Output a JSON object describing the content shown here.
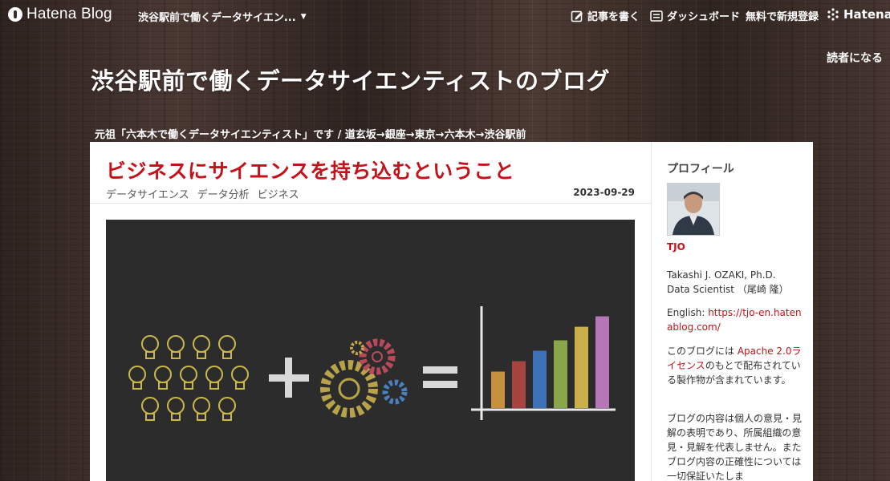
{
  "navbar": {
    "brand": "Hatena Blog",
    "blog_select": "渋谷駅前で働くデータサイエン...",
    "write_post": "記事を書く",
    "dashboard": "ダッシュボード",
    "register": "無料で新規登録",
    "hatena": "Hatena",
    "subscribe": "読者になる"
  },
  "header": {
    "title": "渋谷駅前で働くデータサイエンティストのブログ",
    "description": "元祖「六本木で働くデータサイエンティスト」です / 道玄坂→銀座→東京→六本木→渋谷駅前"
  },
  "entry": {
    "title": "ビジネスにサイエンスを持ち込むということ",
    "categories": [
      "データサイエンス",
      "データ分析",
      "ビジネス"
    ],
    "date": "2023-09-29",
    "eyecatch": {
      "icon": "ideas-plus-gears-equals-chart-illustration",
      "bar_heights": [
        0.35,
        0.45,
        0.55,
        0.65,
        0.78,
        0.88
      ]
    }
  },
  "sidebar": {
    "heading": "プロフィール",
    "name": "TJO",
    "bio_line1": "Takashi J. OZAKI, Ph.D.",
    "bio_line2": "Data Scientist （尾崎 隆）",
    "english_label": "English: ",
    "english_link": "https://tjo-en.hatenablog.com/",
    "license_pre": "このブログには ",
    "license_link": "Apache 2.0ライセンス",
    "license_post": "のもとで配布されている製作物が含まれています。",
    "disclaimer": "ブログの内容は個人の意見・見解の表明であり、所属組織の意見・見解を代表しません。またブログ内容の正確性については一切保証いたしま"
  },
  "colors": {
    "accent": "#c4121a",
    "background": "#3b2d28"
  }
}
